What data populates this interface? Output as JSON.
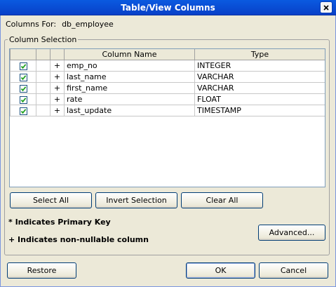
{
  "window": {
    "title": "Table/View Columns",
    "close_icon": "close-icon"
  },
  "columns_for": {
    "label": "Columns For:",
    "value": "db_employee"
  },
  "column_selection": {
    "legend": "Column Selection",
    "headers": [
      "",
      "",
      "",
      "Column Name",
      "Type"
    ],
    "rows": [
      {
        "checked": true,
        "pk": "",
        "nn": "+",
        "name": "emp_no",
        "type": "INTEGER"
      },
      {
        "checked": true,
        "pk": "",
        "nn": "+",
        "name": "last_name",
        "type": "VARCHAR"
      },
      {
        "checked": true,
        "pk": "",
        "nn": "+",
        "name": "first_name",
        "type": "VARCHAR"
      },
      {
        "checked": true,
        "pk": "",
        "nn": "+",
        "name": "rate",
        "type": "FLOAT"
      },
      {
        "checked": true,
        "pk": "",
        "nn": "+",
        "name": "last_update",
        "type": "TIMESTAMP"
      }
    ],
    "buttons": {
      "select_all": "Select All",
      "invert_selection": "Invert Selection",
      "clear_all": "Clear All",
      "advanced": "Advanced..."
    },
    "notes": {
      "primary_key": "* Indicates Primary Key",
      "non_nullable": "+ Indicates non-nullable column"
    }
  },
  "footer": {
    "restore": "Restore",
    "ok": "OK",
    "cancel": "Cancel"
  },
  "colors": {
    "titlebar": "#0a5ae0",
    "dialog_bg": "#ece9d8",
    "button_border": "#003c74"
  }
}
